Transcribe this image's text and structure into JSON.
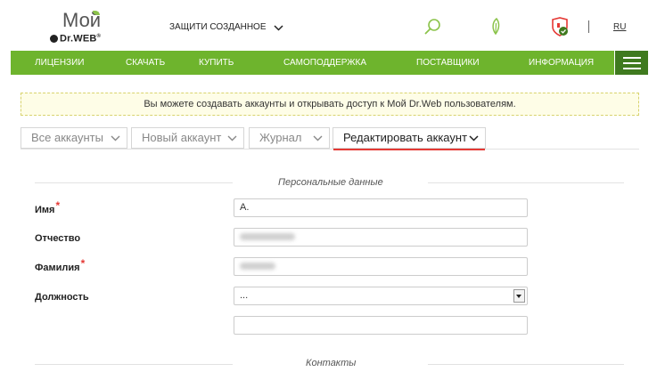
{
  "header": {
    "logo_top": "Мой",
    "logo_brand": "Dr.WEB",
    "protect_label": "ЗАЩИТИ СОЗДАННОЕ",
    "lang": "RU",
    "icons": [
      "search-icon",
      "leaf-icon",
      "shield-icon"
    ],
    "brand_green": "#6eb42d"
  },
  "nav": {
    "items": [
      "ЛИЦЕНЗИИ",
      "СКАЧАТЬ",
      "КУПИТЬ",
      "САМОПОДДЕРЖКА",
      "ПОСТАВЩИКИ",
      "ИНФОРМАЦИЯ"
    ]
  },
  "notice": {
    "text": "Вы можете создавать аккаунты и открывать доступ к Мой Dr.Web пользователям."
  },
  "tabs": [
    {
      "label": "Все аккаунты"
    },
    {
      "label": "Новый аккаунт"
    },
    {
      "label": "Журнал"
    },
    {
      "label": "Редактировать аккаунт",
      "active": true
    }
  ],
  "form": {
    "personal_title": "Персональные данные",
    "contacts_title": "Контакты",
    "name_label": "Имя",
    "name_value": "А.",
    "patronymic_label": "Отчество",
    "surname_label": "Фамилия",
    "position_label": "Должность",
    "position_value": "...",
    "required_mark": "*"
  }
}
